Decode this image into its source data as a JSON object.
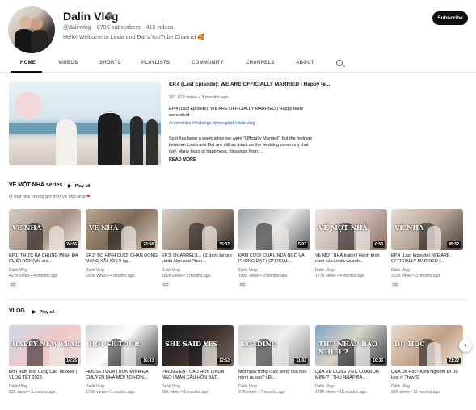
{
  "channel": {
    "name": "Dalin Vlog",
    "handle": "@dalinvlog",
    "subscribers": "870K subscribers",
    "videos": "419 videos",
    "description": "Hello! Welcome to Linda and Đạt's YouTube Channel 🥰",
    "subscribe_label": "Subscribe"
  },
  "tabs": [
    "HOME",
    "VIDEOS",
    "SHORTS",
    "PLAYLISTS",
    "COMMUNITY",
    "CHANNELS",
    "ABOUT"
  ],
  "featured": {
    "title": "EP.4 (Last Episode): WE ARE OFFICIALLY MARRIED | Happy te...",
    "views": "201,822 views",
    "age": "3 months ago",
    "para1": "EP.4 (Last Episode): WE ARE OFFICIALLY MARRIED | Happy tears were shed",
    "tags": "#vemotnha #lindango #phongdat #dalinvlog",
    "para2": "So it has been a week since we were \"Officially Married\", but the feelings between Linda and Đạt are still as intact as the wedding ceremony that day. Many tears of happiness, blessings from ...",
    "read_more": "READ MORE"
  },
  "section1": {
    "title": "VỀ MỘT NHÀ series",
    "play_all": "Play all",
    "subtitle": "Ở một nhà nhưng giờ mới Về Một Nhà",
    "videos": [
      {
        "title": "EP.1: THỰC RA CHÚNG MÌNH ĐÃ CƯỚI RỒI! (We are...",
        "channel": "Dalin Vlog",
        "stats": "427K views • 4 months ago",
        "duration": "24:06",
        "label": "VỀ NHÀ",
        "cc": "CC"
      },
      {
        "title": "EP.2: BỒ HÌNH CƯỚI CHẮN ĐỘNG MẠNG XÃ HỘI | 9 ng...",
        "channel": "Dalin Vlog",
        "stats": "220K views • 4 months ago",
        "duration": "23:58",
        "label": "VỀ NHÀ",
        "cc": ""
      },
      {
        "title": "EP.3: QUARRELS... | 2 days before Linda Ngo and Phon...",
        "channel": "Dalin Vlog",
        "stats": "161K views • 3 months ago",
        "duration": "35:02",
        "label": "",
        "cc": "CC"
      },
      {
        "title": "ĐÁM CƯỚI CỦA LINDA NGÔ VÀ PHONG ĐẠT | OFFICIAL...",
        "channel": "Dalin Vlog",
        "stats": "100K views • 3 months ago",
        "duration": "5:07",
        "label": "",
        "cc": "CC"
      },
      {
        "title": "VỀ MỘT NHÀ trailer | Hành trình cưới của Linda và anh...",
        "channel": "Dalin Vlog",
        "stats": "177K views • 4 months ago",
        "duration": "0:53",
        "label": "VỀ MỘT NHÀ",
        "cc": ""
      },
      {
        "title": "EP.4 (Last Episode): WE ARE OFFICIALLY MARRIED |...",
        "channel": "Dalin Vlog",
        "stats": "201K views • 3 months ago",
        "duration": "45:52",
        "label": "VỀ NHÀ",
        "cc": "CC"
      }
    ]
  },
  "section2": {
    "title": "VLOG",
    "play_all": "Play all",
    "videos": [
      {
        "title": "Đón Năm Mới Cùng Các Tiktoker | VLOG TẾT 2023",
        "channel": "Dalin Vlog",
        "stats": "62K views • 5 months ago",
        "duration": "14:25",
        "label": "HAPPY NEW YEAR"
      },
      {
        "title": "HOUSE TOUR | BỌN MÌNH ĐÃ CHUYỂN NHÀ MỚI TO HƠN...",
        "channel": "Dalin Vlog",
        "stats": "178K views • 5 months ago",
        "duration": "16:33",
        "label": "HOUSE TOUR"
      },
      {
        "title": "PHONG ĐẠT CẦU HÔN LINDA NGO | MÀN CẦU HÔN BẤT...",
        "channel": "Dalin Vlog",
        "stats": "99K views • 6 months ago",
        "duration": "12:52",
        "label": "SHE SAID YES"
      },
      {
        "title": "Một ngày trong cuộc sống của bọn mình ra sao? | Đi...",
        "channel": "Dalin Vlog",
        "stats": "27K views • 7 months ago",
        "duration": "11:02",
        "label": "LOADING"
      },
      {
        "title": "Q&A VỀ CÔNG VIỆC CỦA BỌN MÌNH? | THU NHẬP BA...",
        "channel": "Dalin Vlog",
        "stats": "178K views • 10 months ago",
        "duration": "16:33",
        "label": "THU NHẬP BAO NHIÊU?"
      },
      {
        "title": "Q&A Du Học? Kinh Nghiệm Đi Du Học ở Thụy Sĩ",
        "channel": "Dalin Vlog",
        "stats": "91K views • 11 months ago",
        "duration": "21:22",
        "label": "DU HỌC"
      }
    ]
  },
  "colors": {
    "accent": "#065fd4",
    "dark": "#0f0f0f",
    "muted": "#606060"
  }
}
